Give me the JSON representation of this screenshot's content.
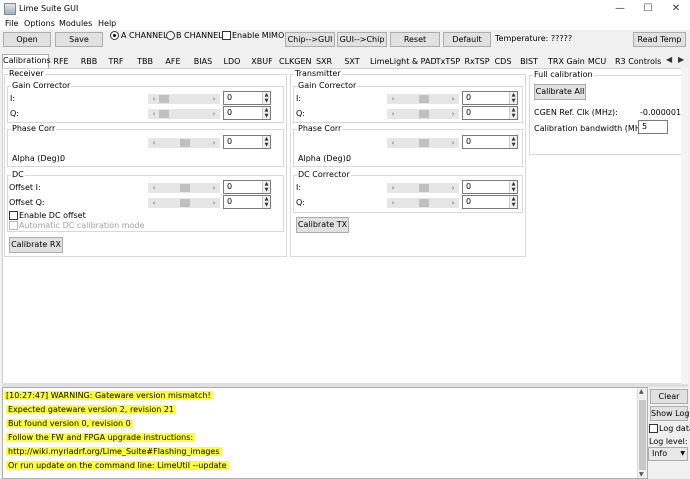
{
  "window": {
    "title": "Lime Suite GUI",
    "minimize": "—",
    "maximize": "☐",
    "close": "✕"
  },
  "menu": [
    "File",
    "Options",
    "Modules",
    "Help"
  ],
  "toolbar": {
    "open": "Open",
    "save": "Save",
    "a_channel": "A CHANNEL",
    "b_channel": "B CHANNEL",
    "enable_mimo": "Enable MIMO",
    "chip_to_gui": "Chip-->GUI",
    "gui_to_chip": "GUI-->Chip",
    "reset": "Reset",
    "default": "Default",
    "temperature": "Temperature: ?????",
    "read_temp": "Read Temp"
  },
  "tabs": [
    "Calibrations",
    "RFE",
    "RBB",
    "TRF",
    "TBB",
    "AFE",
    "BIAS",
    "LDO",
    "XBUF",
    "CLKGEN",
    "SXR",
    "SXT",
    "LimeLight & PAD",
    "TxTSP",
    "RxTSP",
    "CDS",
    "BIST",
    "TRX Gain",
    "MCU",
    "R3 Controls"
  ],
  "receiver": {
    "title": "Receiver",
    "gain": {
      "title": "Gain Corrector",
      "i_label": "I:",
      "i_value": "0",
      "q_label": "Q:",
      "q_value": "0"
    },
    "phase": {
      "title": "Phase Corr",
      "value": "0",
      "alpha_label": "Alpha (Deg):",
      "alpha_value": "0"
    },
    "dc": {
      "title": "DC",
      "offset_i_label": "Offset I:",
      "offset_i_value": "0",
      "offset_q_label": "Offset Q:",
      "offset_q_value": "0",
      "enable_dc": "Enable DC offset",
      "auto_dc": "Automatic DC calibration mode"
    },
    "calibrate": "Calibrate RX"
  },
  "transmitter": {
    "title": "Transmitter",
    "gain": {
      "title": "Gain Corrector",
      "i_label": "I:",
      "i_value": "0",
      "q_label": "Q:",
      "q_value": "0"
    },
    "phase": {
      "title": "Phase Corr",
      "value": "0",
      "alpha_label": "Alpha (Deg):",
      "alpha_value": "0"
    },
    "dc": {
      "title": "DC Corrector",
      "i_label": "I:",
      "i_value": "0",
      "q_label": "Q:",
      "q_value": "0"
    },
    "calibrate": "Calibrate TX"
  },
  "full_calibration": {
    "title": "Full calibration",
    "calibrate_all": "Calibrate All",
    "cgen_label": "CGEN Ref. Clk (MHz):",
    "cgen_value": "-0.000001",
    "bw_label": "Calibration bandwidth (MHz):",
    "bw_value": "5"
  },
  "log": {
    "lines": [
      "[10:27:47] WARNING: Gateware version mismatch!",
      "Expected gateware version 2, revision 21",
      "But found version 0, revision 0",
      "Follow the FW and FPGA upgrade instructions:",
      "http://wiki.myriadrf.org/Lime_Suite#Flashing_images",
      "Or run update on the command line: LimeUtil --update"
    ],
    "clear": "Clear",
    "show_log": "Show Log",
    "log_data": "Log data",
    "log_level_label": "Log level:",
    "log_level_value": "Info"
  },
  "colors": {
    "log_highlight": "#ffff33"
  }
}
